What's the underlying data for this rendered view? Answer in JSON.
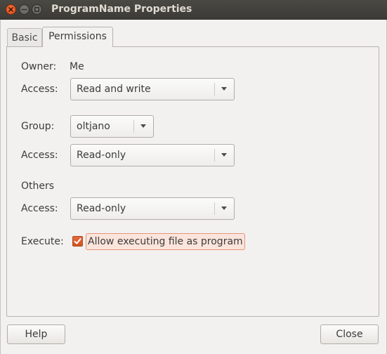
{
  "window": {
    "title": "ProgramName Properties",
    "controls": [
      "close-icon",
      "minimize-icon",
      "maximize-icon"
    ]
  },
  "tabs": [
    {
      "label": "Basic",
      "selected": false
    },
    {
      "label": "Permissions",
      "selected": true
    }
  ],
  "permissions": {
    "owner_label": "Owner:",
    "owner_value": "Me",
    "owner_access_label": "Access:",
    "owner_access_value": "Read and write",
    "group_label": "Group:",
    "group_value": "oltjano",
    "group_access_label": "Access:",
    "group_access_value": "Read-only",
    "others_label": "Others",
    "others_access_label": "Access:",
    "others_access_value": "Read-only",
    "execute_label": "Execute:",
    "execute_checkbox_label": "Allow executing file as program",
    "execute_checked": true
  },
  "buttons": {
    "help": "Help",
    "close": "Close"
  },
  "colors": {
    "accent": "#dd4814",
    "titlebar": "#3c3b37",
    "window_bg": "#f2f1f0"
  }
}
